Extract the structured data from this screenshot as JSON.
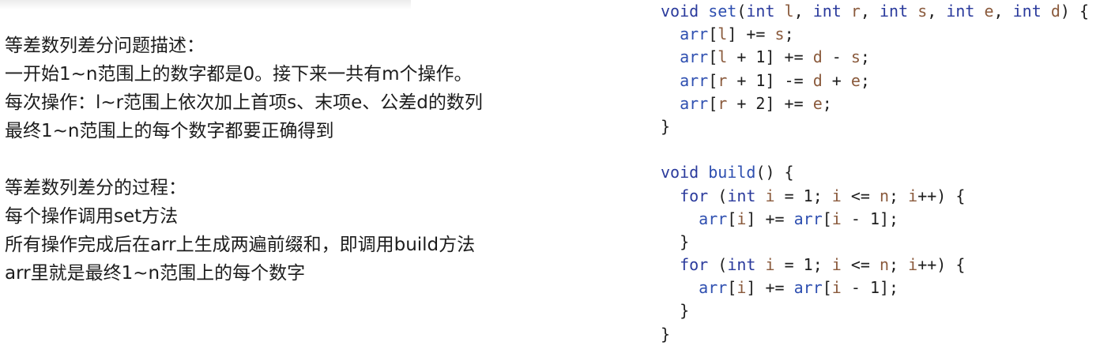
{
  "left_text": {
    "section1": {
      "title": "等差数列差分问题描述：",
      "lines": [
        "一开始1~n范围上的数字都是0。接下来一共有m个操作。",
        "每次操作：l~r范围上依次加上首项s、末项e、公差d的数列",
        "最终1~n范围上的每个数字都要正确得到"
      ]
    },
    "section2": {
      "title": "等差数列差分的过程：",
      "lines": [
        "每个操作调用set方法",
        "所有操作完成后在arr上生成两遍前缀和，即调用build方法",
        "arr里就是最终1~n范围上的每个数字"
      ]
    }
  },
  "code": {
    "lines": [
      "void set(int l, int r, int s, int e, int d) {",
      "  arr[l] += s;",
      "  arr[l + 1] += d - s;",
      "  arr[r + 1] -= d + e;",
      "  arr[r + 2] += e;",
      "}",
      "",
      "void build() {",
      "  for (int i = 1; i <= n; i++) {",
      "    arr[i] += arr[i - 1];",
      "  }",
      "  for (int i = 1; i <= n; i++) {",
      "    arr[i] += arr[i - 1];",
      "  }",
      "}"
    ]
  },
  "colors": {
    "keyword": "#2a3a9c",
    "identifier": "#2e4fb0",
    "variable": "#8a5a3c",
    "plain": "#1e1e1e"
  }
}
